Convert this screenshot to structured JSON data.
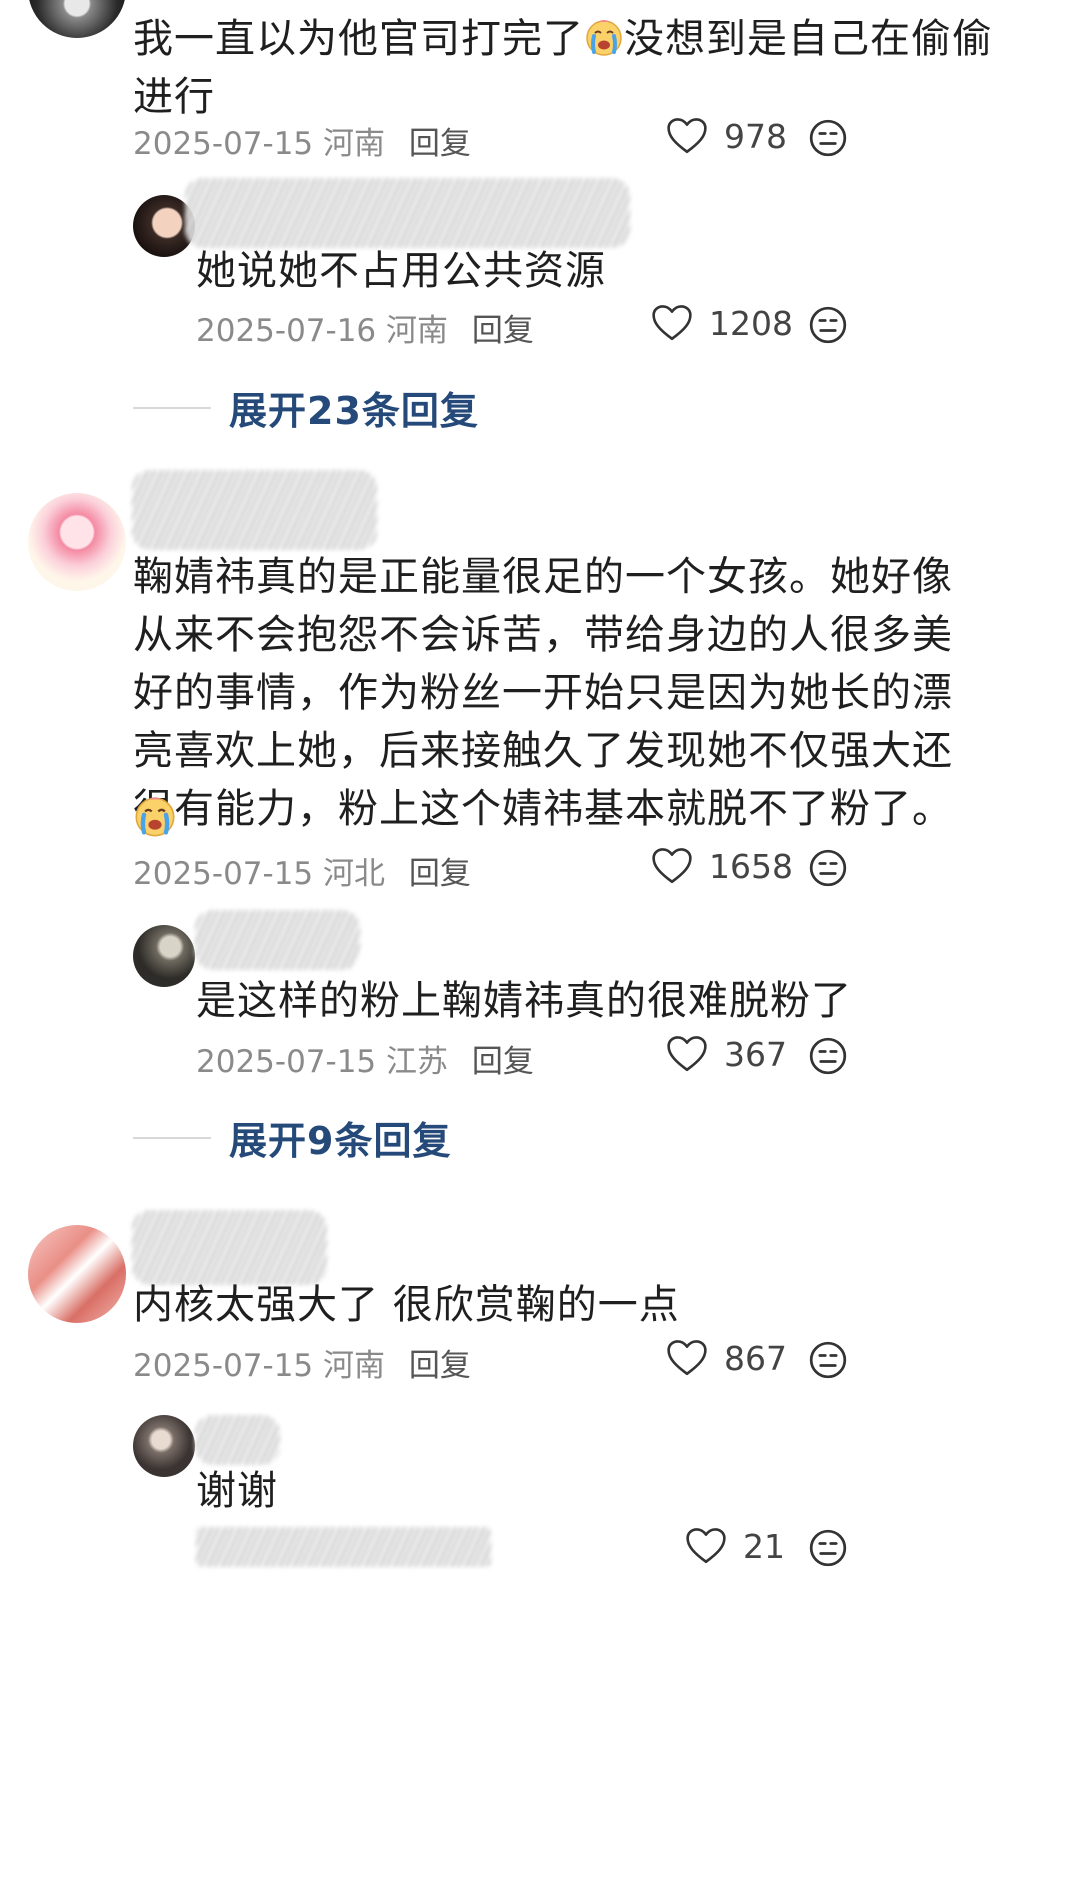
{
  "comments": [
    {
      "text": "我一直以为他官司打完了😭没想到是自己在偷偷进行",
      "text_part1": "我一直以为他官司打完了",
      "text_part2": "没想到是自己在偷偷进行",
      "date": "2025-07-15",
      "location": "河南",
      "reply_label": "回复",
      "likes": "978",
      "replies": [
        {
          "text": "她说她不占用公共资源",
          "date": "2025-07-16",
          "location": "河南",
          "reply_label": "回复",
          "likes": "1208"
        }
      ],
      "expand_label": "展开23条回复"
    },
    {
      "text": "鞠婧祎真的是正能量很足的一个女孩。她好像从来不会抱怨不会诉苦，带给身边的人很多美好的事情，作为粉丝一开始只是因为她长的漂亮喜欢上她，后来接触久了发现她不仅强大还很有能力，粉上这个婧祎基本就脱不了粉了。",
      "lines": [
        "鞠婧祎真的是正能量很足的一个女孩。她好像",
        "从来不会抱怨不会诉苦，带给身边的人很多美",
        "好的事情，作为粉丝一开始只是因为她长的漂",
        "亮喜欢上她，后来接触久了发现她不仅强大还",
        "很有能力，粉上这个婧祎基本就脱不了粉了。"
      ],
      "date": "2025-07-15",
      "location": "河北",
      "reply_label": "回复",
      "likes": "1658",
      "replies": [
        {
          "text": "是这样的粉上鞠婧祎真的很难脱粉了",
          "date": "2025-07-15",
          "location": "江苏",
          "reply_label": "回复",
          "likes": "367"
        }
      ],
      "expand_label": "展开9条回复"
    },
    {
      "text": "内核太强大了 很欣赏鞠的一点",
      "date": "2025-07-15",
      "location": "河南",
      "reply_label": "回复",
      "likes": "867",
      "replies": [
        {
          "text": "谢谢",
          "likes": "21"
        }
      ]
    }
  ],
  "icons": {
    "like": "heart-outline-icon",
    "dislike": "neutral-face-icon",
    "emoji": "crying-face-emoji"
  },
  "colors": {
    "expand_link": "#254a7a",
    "meta_text": "#8a8a8a",
    "body_text": "#1f1f1f"
  }
}
